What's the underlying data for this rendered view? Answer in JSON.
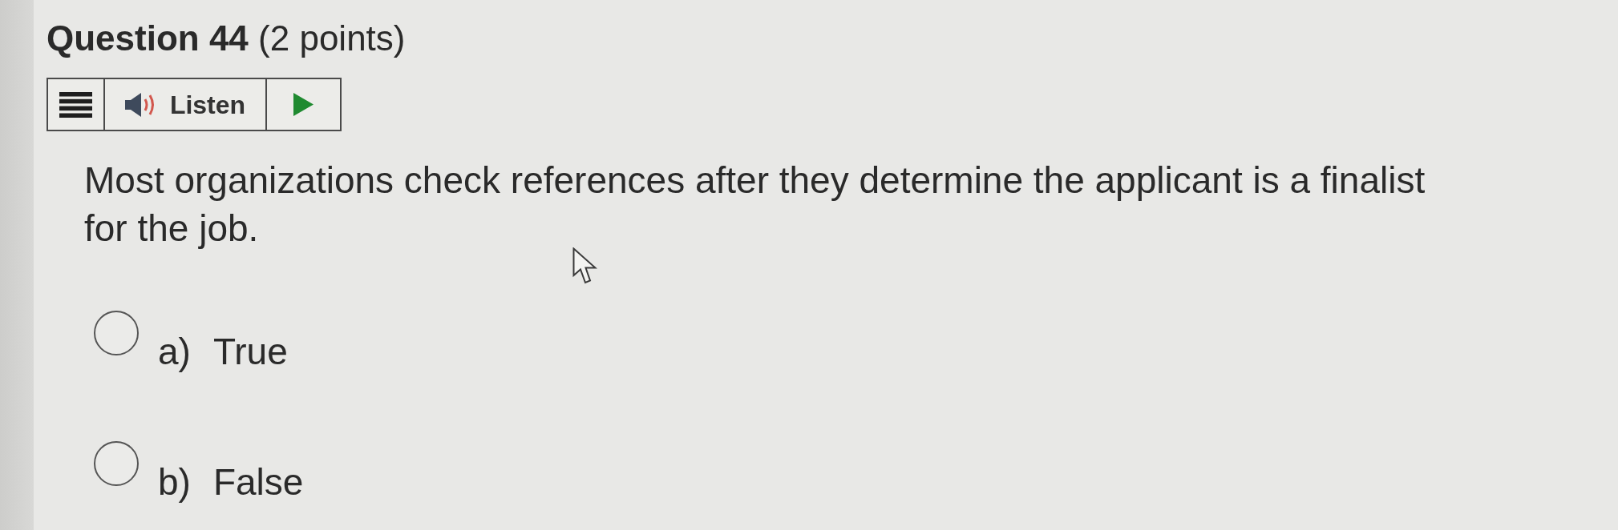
{
  "question": {
    "title": "**Question 44** (2 points)"
  },
  "listen_bar": {
    "label": "Listen"
  },
  "prompt": "Most organizations check references after they determine the applicant is a finalist for the job.",
  "options": [
    {
      "letter": "a)",
      "label": "True",
      "selected": false
    },
    {
      "letter": "b)",
      "label": "False",
      "selected": false
    }
  ]
}
